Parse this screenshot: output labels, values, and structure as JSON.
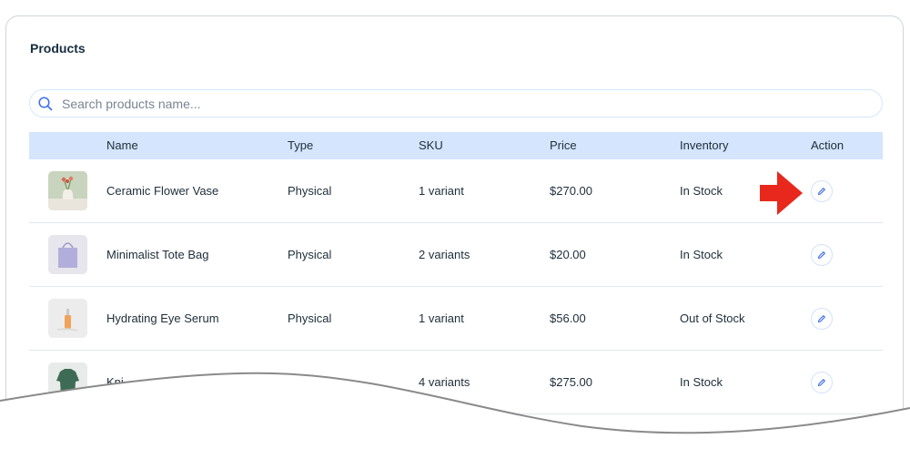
{
  "page": {
    "title": "Products"
  },
  "search": {
    "placeholder": "Search products name..."
  },
  "table": {
    "columns": [
      "Name",
      "Type",
      "SKU",
      "Price",
      "Inventory",
      "Action"
    ],
    "rows": [
      {
        "name": "Ceramic Flower Vase",
        "type": "Physical",
        "sku": "1 variant",
        "price": "$270.00",
        "inventory": "In Stock",
        "thumb_icon": "flower-vase-icon"
      },
      {
        "name": "Minimalist Tote Bag",
        "type": "Physical",
        "sku": "2 variants",
        "price": "$20.00",
        "inventory": "In Stock",
        "thumb_icon": "tote-bag-icon"
      },
      {
        "name": "Hydrating Eye Serum",
        "type": "Physical",
        "sku": "1 variant",
        "price": "$56.00",
        "inventory": "Out of Stock",
        "thumb_icon": "serum-bottle-icon"
      },
      {
        "name": "Kni",
        "type": "",
        "sku": "4 variants",
        "price": "$275.00",
        "inventory": "In Stock",
        "thumb_icon": "sweater-icon"
      }
    ]
  },
  "colors": {
    "header_bg": "#d5e5fd",
    "accent": "#3b6df0",
    "arrow": "#e8281c"
  },
  "icons": {
    "search": "search-icon",
    "edit": "pencil-icon",
    "pointer": "arrow-pointer-icon"
  }
}
